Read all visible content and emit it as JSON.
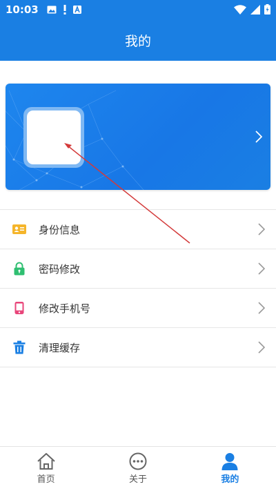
{
  "status_bar": {
    "time": "10:03",
    "icons_left": [
      "image-notification-icon",
      "alert-notification-icon",
      "app-notification-icon"
    ],
    "icons_right": [
      "wifi-icon",
      "signal-icon",
      "battery-charging-icon"
    ]
  },
  "header": {
    "title": "我的"
  },
  "profile_card": {
    "chevron": "chevron-right-icon"
  },
  "menu": {
    "items": [
      {
        "label": "身份信息",
        "icon": "id-card-icon",
        "color": "#f5b52a"
      },
      {
        "label": "密码修改",
        "icon": "lock-icon",
        "color": "#2fbf71"
      },
      {
        "label": "修改手机号",
        "icon": "phone-icon",
        "color": "#e8457a"
      },
      {
        "label": "清理缓存",
        "icon": "trash-icon",
        "color": "#1a7fe3"
      }
    ]
  },
  "bottom_nav": {
    "items": [
      {
        "label": "首页",
        "icon": "home-icon"
      },
      {
        "label": "关于",
        "icon": "chat-icon"
      },
      {
        "label": "我的",
        "icon": "user-icon",
        "active": true
      }
    ]
  },
  "colors": {
    "primary": "#1a7fe3",
    "annotation_arrow": "#d33a3a",
    "divider": "#e6e6e6"
  }
}
